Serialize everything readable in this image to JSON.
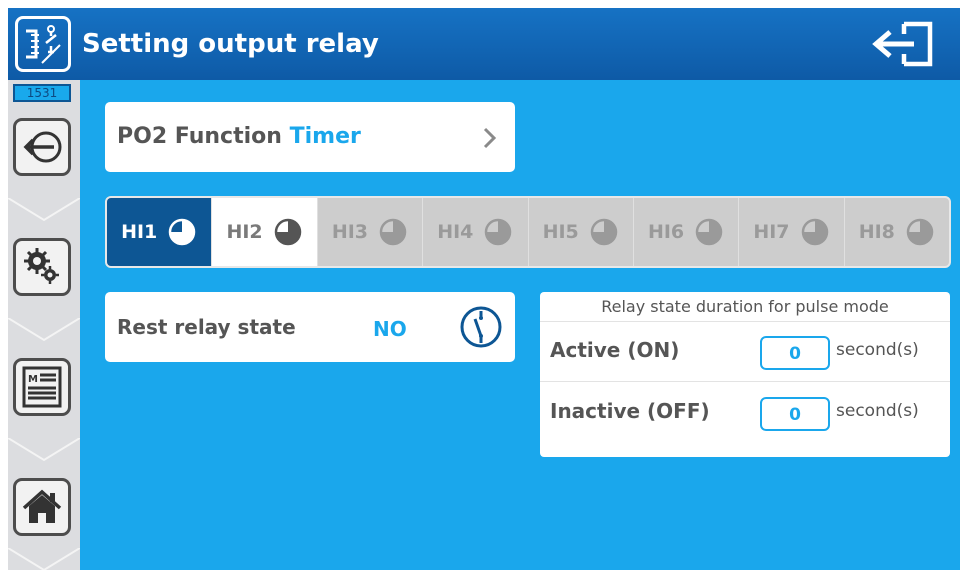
{
  "header": {
    "title": "Setting output relay",
    "app_icon": "relay-config-icon",
    "exit_icon": "exit-icon"
  },
  "sidebar": {
    "counter": "1531",
    "buttons": [
      {
        "icon": "back-arrow-icon"
      },
      {
        "icon": "gears-icon"
      },
      {
        "icon": "menu-list-icon"
      },
      {
        "icon": "home-icon"
      }
    ]
  },
  "function": {
    "label": "PO2 Function",
    "value": "Timer"
  },
  "tabs": [
    {
      "label": "HI1",
      "state": "active"
    },
    {
      "label": "HI2",
      "state": "selected"
    },
    {
      "label": "HI3",
      "state": "disabled"
    },
    {
      "label": "HI4",
      "state": "disabled"
    },
    {
      "label": "HI5",
      "state": "disabled"
    },
    {
      "label": "HI6",
      "state": "disabled"
    },
    {
      "label": "HI7",
      "state": "disabled"
    },
    {
      "label": "HI8",
      "state": "disabled"
    }
  ],
  "rest": {
    "label": "Rest relay state",
    "value": "NO"
  },
  "pulse": {
    "title": "Relay state duration for pulse mode",
    "active_label": "Active (ON)",
    "active_value": "0",
    "inactive_label": "Inactive (OFF)",
    "inactive_value": "0",
    "unit": "second(s)"
  },
  "colors": {
    "header": "#0e5aa6",
    "content_bg": "#1aa7ec",
    "accent": "#1aa7ec",
    "active_tab": "#0d5694"
  }
}
